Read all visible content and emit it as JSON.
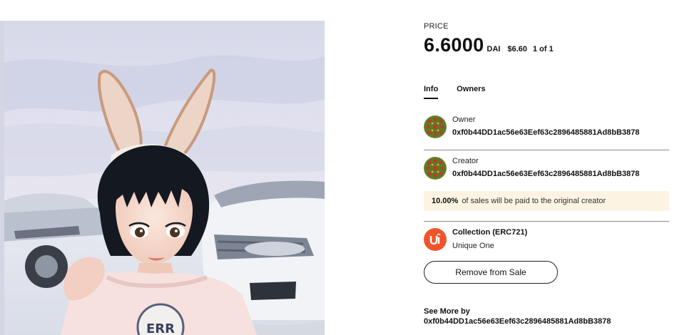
{
  "price": {
    "label": "PRICE",
    "value": "6.6000",
    "currency": "DAI",
    "usd": "$6.60",
    "edition": "1 of 1"
  },
  "tabs": [
    {
      "label": "Info",
      "active": true
    },
    {
      "label": "Owners",
      "active": false
    }
  ],
  "owner": {
    "role": "Owner",
    "address": "0xf0b44DD1ac56e63Eef63c2896485881Ad8bB3878"
  },
  "creator": {
    "role": "Creator",
    "address": "0xf0b44DD1ac56e63Eef63c2896485881Ad8bB3878"
  },
  "royalty": {
    "percent": "10.00%",
    "text": "of sales will be paid to the original creator"
  },
  "collection": {
    "title": "Collection (ERC721)",
    "name": "Unique One",
    "logo_icon": "unique-one-logo-icon",
    "logo_color": "#f0542b"
  },
  "actions": {
    "remove_label": "Remove from Sale"
  },
  "see_more": {
    "label": "See More by",
    "address": "0xf0b44DD1ac56e63Eef63c2896485881Ad8bB3878"
  },
  "colors": {
    "royalty_bg": "#fcf3e3",
    "avatar_green": "#5a7a2a",
    "avatar_red": "#c0392b"
  }
}
